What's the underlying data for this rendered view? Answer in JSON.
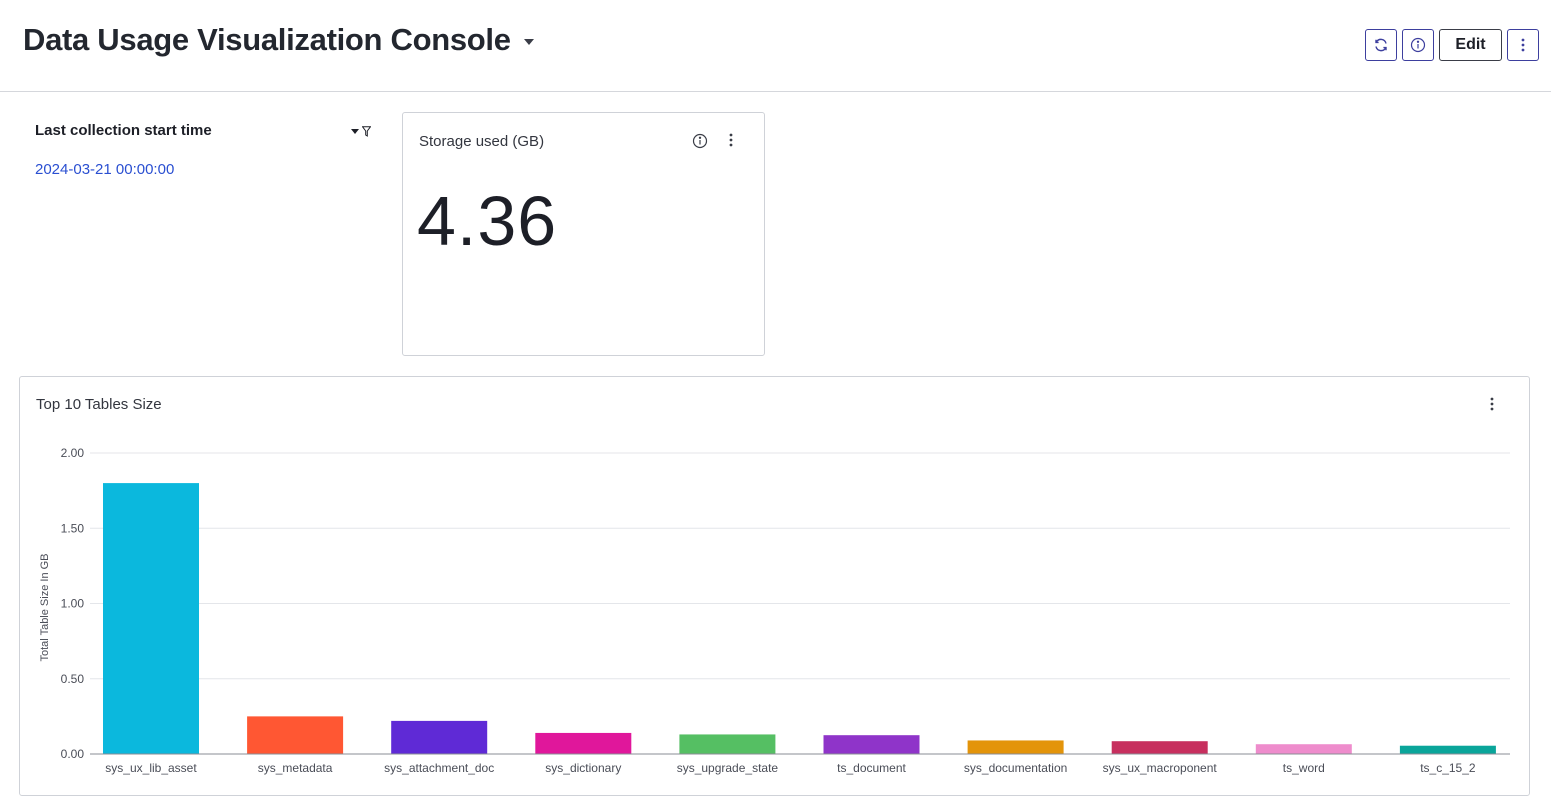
{
  "header": {
    "title": "Data Usage Visualization Console",
    "edit_label": "Edit",
    "icons": [
      "refresh-icon",
      "info-icon",
      "more-vertical-icon"
    ]
  },
  "filter": {
    "title": "Last collection start time",
    "value": "2024-03-21 00:00:00",
    "link_color": "#2a4fd1"
  },
  "storage": {
    "title": "Storage used (GB)",
    "value": "4.36"
  },
  "chart": {
    "title": "Top 10 Tables Size"
  },
  "chart_data": {
    "type": "bar",
    "title": "Top 10 Tables Size",
    "xlabel": "",
    "ylabel": "Total Table Size In GB",
    "ylim": [
      0,
      2.0
    ],
    "yticks": [
      "0.00",
      "0.50",
      "1.00",
      "1.50",
      "2.00"
    ],
    "grid": true,
    "categories": [
      "sys_ux_lib_asset",
      "sys_metadata",
      "sys_attachment_doc",
      "sys_dictionary",
      "sys_upgrade_state",
      "ts_document",
      "sys_documentation",
      "sys_ux_macroponent",
      "ts_word",
      "ts_c_15_2"
    ],
    "values": [
      1.8,
      0.25,
      0.22,
      0.14,
      0.13,
      0.125,
      0.09,
      0.085,
      0.065,
      0.055
    ],
    "colors": [
      "#0bb8dd",
      "#ff5733",
      "#5f2ad6",
      "#e0179b",
      "#55bf63",
      "#8f34c9",
      "#e3940a",
      "#c72f5e",
      "#ee8ccc",
      "#0aa59a"
    ]
  }
}
